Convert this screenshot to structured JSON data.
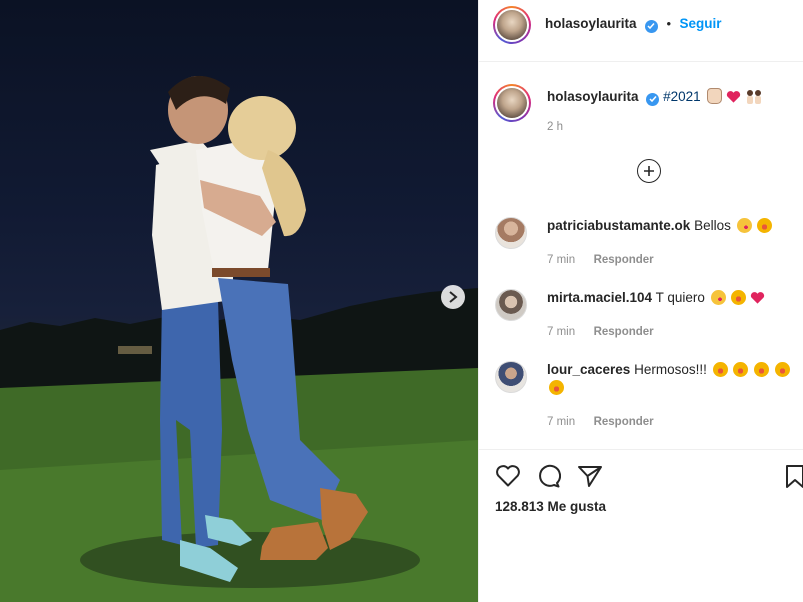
{
  "post": {
    "author": "holasoylaurita",
    "follow_label": "Seguir",
    "separator": "•"
  },
  "caption": {
    "author": "holasoylaurita",
    "hashtag": "#2021",
    "emoji": [
      "hand",
      "heart",
      "couple"
    ],
    "time": "2 h"
  },
  "comments": [
    {
      "user": "patriciabustamante.ok",
      "text": "Bellos",
      "emoji": [
        "kiss",
        "star"
      ],
      "time": "7 min",
      "reply": "Responder"
    },
    {
      "user": "mirta.maciel.104",
      "text": "T quiero",
      "emoji": [
        "kiss",
        "star",
        "heart"
      ],
      "time": "7 min",
      "reply": "Responder"
    },
    {
      "user": "lour_caceres",
      "text": "Hermosos!!!",
      "emoji": [
        "star",
        "star",
        "star",
        "star",
        "star"
      ],
      "time": "7 min",
      "reply": "Responder"
    }
  ],
  "actions": {
    "icons": [
      "heart-icon",
      "comment-icon",
      "share-icon",
      "bookmark-icon"
    ],
    "likes": "128.813 Me gusta"
  },
  "colors": {
    "accent": "#0095f6",
    "verified": "#3897f0",
    "hashtag": "#00376b",
    "muted": "#8e8e8e"
  }
}
